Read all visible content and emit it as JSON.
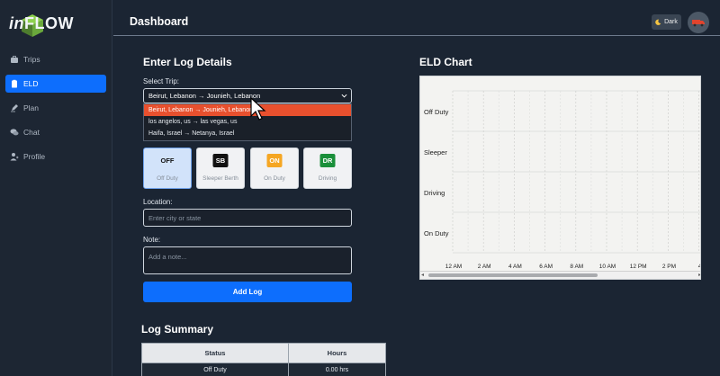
{
  "app": {
    "logo_prefix": "in",
    "logo_suffix": "FLOW"
  },
  "sidebar": {
    "items": [
      {
        "label": "Trips",
        "icon": "suitcase-icon"
      },
      {
        "label": "ELD",
        "icon": "clipboard-icon",
        "active": true
      },
      {
        "label": "Plan",
        "icon": "pen-icon"
      },
      {
        "label": "Chat",
        "icon": "chat-icon"
      },
      {
        "label": "Profile",
        "icon": "user-icon"
      }
    ]
  },
  "header": {
    "title": "Dashboard",
    "theme_label": "Dark",
    "theme_icon": "moon-icon",
    "avatar_icon": "truck-icon"
  },
  "form": {
    "title": "Enter Log Details",
    "trip_label": "Select Trip:",
    "selected_trip": "Beirut, Lebanon → Jounieh, Lebanon",
    "trip_options": [
      "Beirut, Lebanon → Jounieh, Lebanon",
      "los angelos, us → las vegas, us",
      "Haifa, Israel → Netanya, Israel"
    ],
    "statuses": [
      {
        "code": "OFF",
        "name": "Off Duty",
        "bg": "#f1f2f4",
        "fg": "#111111",
        "selected": true
      },
      {
        "code": "SB",
        "name": "Sleeper Berth",
        "bg": "#111111",
        "fg": "#ffffff"
      },
      {
        "code": "ON",
        "name": "On Duty",
        "bg": "#f5a623",
        "fg": "#ffffff"
      },
      {
        "code": "DR",
        "name": "Driving",
        "bg": "#1a8f3a",
        "fg": "#ffffff"
      }
    ],
    "location_label": "Location:",
    "location_placeholder": "Enter city or state",
    "note_label": "Note:",
    "note_placeholder": "Add a note...",
    "submit_label": "Add Log"
  },
  "summary": {
    "title": "Log Summary",
    "columns": [
      "Status",
      "Hours"
    ],
    "rows": [
      {
        "status": "Off Duty",
        "hours": "0.00 hrs"
      }
    ]
  },
  "chart": {
    "title": "ELD Chart",
    "rows": [
      "Off Duty",
      "Sleeper",
      "Driving",
      "On Duty"
    ],
    "time_labels": [
      "12 AM",
      "2 AM",
      "4 AM",
      "6 AM",
      "8 AM",
      "10 AM",
      "12 PM",
      "2 PM",
      "4"
    ],
    "scroll_left": "◂",
    "scroll_right": "▸"
  },
  "colors": {
    "accent": "#0d6efd",
    "highlight": "#e8502e"
  }
}
